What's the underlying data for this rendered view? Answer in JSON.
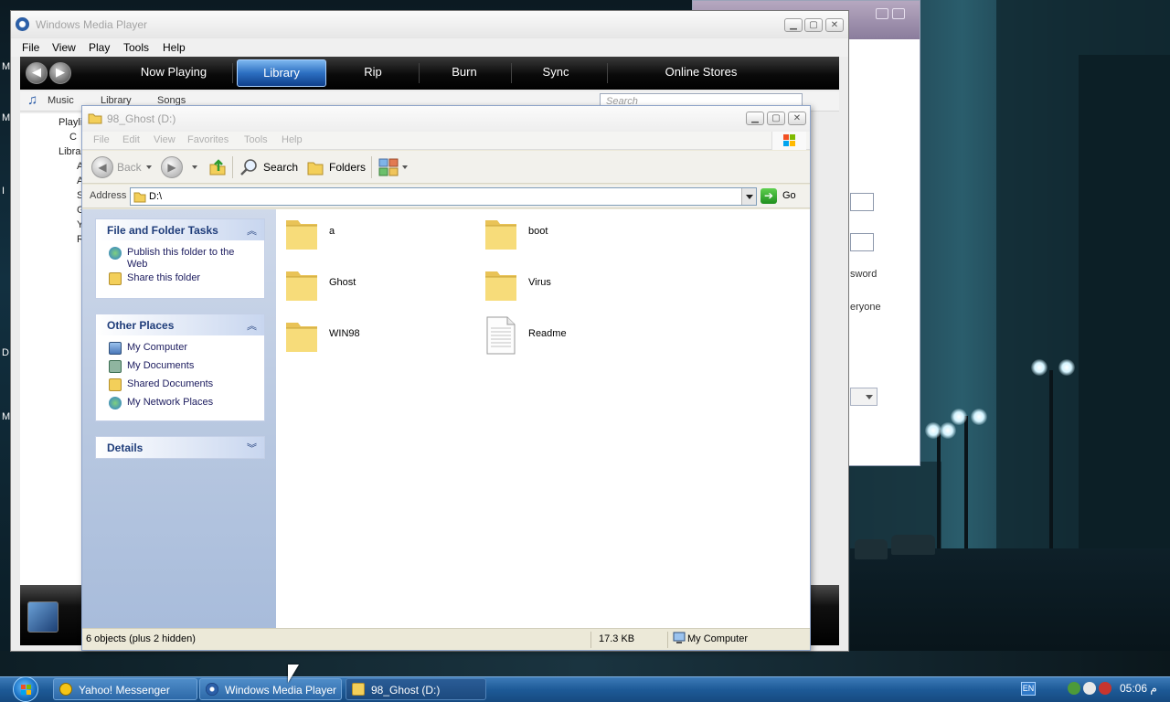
{
  "wmp": {
    "title": "Windows Media Player",
    "menu": [
      "File",
      "View",
      "Play",
      "Tools",
      "Help"
    ],
    "tabs": [
      "Now Playing",
      "Library",
      "Rip",
      "Burn",
      "Sync",
      "Online Stores"
    ],
    "active_tab": "Library",
    "breadcrumb": [
      "Music",
      "Library",
      "Songs"
    ],
    "search_placeholder": "Search",
    "left_items": [
      "Playli",
      "C",
      "Librar",
      "A",
      "A",
      "S",
      "G",
      "Y",
      "R"
    ]
  },
  "background_dialog": {
    "text1": "sword",
    "text2": "eryone"
  },
  "edge_letters": [
    "M",
    "M",
    "I",
    "D",
    "M"
  ],
  "explorer": {
    "title": "98_Ghost (D:)",
    "menu": [
      "File",
      "Edit",
      "View",
      "Favorites",
      "Tools",
      "Help"
    ],
    "toolbar": {
      "back": "Back",
      "search": "Search",
      "folders": "Folders"
    },
    "address_label": "Address",
    "address_value": "D:\\",
    "go_label": "Go",
    "panels": {
      "tasks": {
        "title": "File and Folder Tasks",
        "items": [
          "Publish this folder to the Web",
          "Share this folder"
        ]
      },
      "places": {
        "title": "Other Places",
        "items": [
          "My Computer",
          "My Documents",
          "Shared Documents",
          "My Network Places"
        ]
      },
      "details": {
        "title": "Details"
      }
    },
    "files": [
      {
        "name": "a",
        "type": "folder"
      },
      {
        "name": "boot",
        "type": "folder"
      },
      {
        "name": "Ghost",
        "type": "folder"
      },
      {
        "name": "Virus",
        "type": "folder"
      },
      {
        "name": "WIN98",
        "type": "folder"
      },
      {
        "name": "Readme",
        "type": "document"
      }
    ],
    "status": {
      "objects": "6 objects (plus 2 hidden)",
      "size": "17.3 KB",
      "location": "My Computer"
    }
  },
  "taskbar": {
    "buttons": [
      {
        "label": "Yahoo! Messenger",
        "icon": "yahoo-messenger-icon"
      },
      {
        "label": "Windows Media Player",
        "icon": "wmp-icon"
      },
      {
        "label": "98_Ghost (D:)",
        "icon": "folder-icon"
      }
    ],
    "language": "EN",
    "clock": "05:06 م"
  },
  "colors": {
    "explorer_panel_title": "#1f3d7a",
    "wmp_active_tab": "#2c6fc1",
    "taskbar": "#1d5a97"
  }
}
